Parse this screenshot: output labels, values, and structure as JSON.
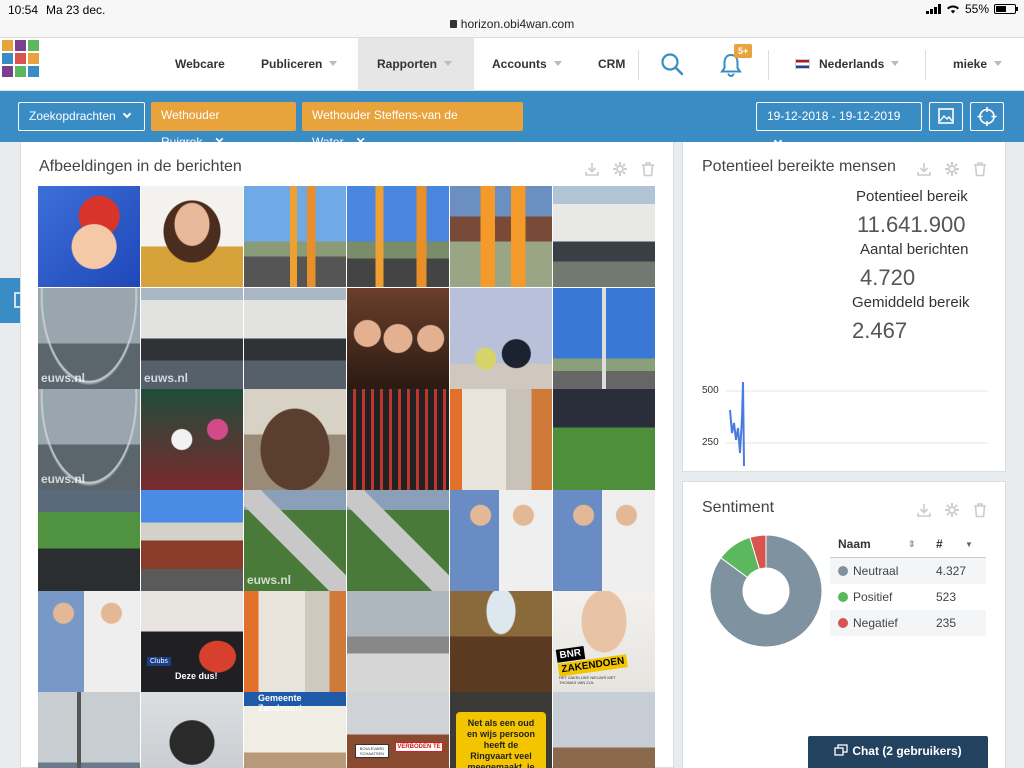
{
  "status": {
    "time": "10:54",
    "date": "Ma 23 dec.",
    "url": "horizon.obi4wan.com",
    "battery": "55%",
    "battery_level": 0.55
  },
  "nav": {
    "webcare": "Webcare",
    "publiceren": "Publiceren",
    "rapporten": "Rapporten",
    "accounts": "Accounts",
    "crm": "CRM",
    "notifications_badge": "5+",
    "language": "Nederlands",
    "user": "mieke"
  },
  "filters": {
    "query_dropdown": "Zoekopdrachten",
    "tags": [
      "Wethouder Ruigrok",
      "Wethouder Steffens-van de Water"
    ],
    "date_range": "19-12-2018 - 19-12-2019"
  },
  "images_panel": {
    "title": "Afbeeldingen in de berichten",
    "watermark": "euws.nl",
    "bnr_brand": "BNR",
    "bnr_show": "ZAKENDOEN",
    "bnr_tagline": "HET ZAKELIJKE NIEUWS MET THOMAS VAN ZIJL",
    "poster_a": "Deze dus!",
    "poster_b": "Clubs",
    "place_sign": "Gemeente Zandvoort",
    "street_sign": "VERBODEN TE",
    "street_sign_2": "BOULEVARD SCHAATSEN",
    "billboard": "Net als een oud en wijs persoon heeft de Ringvaart veel meegemaakt, je moet voorzichtig"
  },
  "reach_panel": {
    "title": "Potentieel bereikte mensen",
    "potential_reach_label": "Potentieel bereik",
    "potential_reach_value": "11.641.900",
    "messages_label": "Aantal berichten",
    "messages_value": "4.720",
    "avg_label": "Gemiddeld bereik",
    "avg_value": "2.467",
    "y_ticks": [
      "500",
      "250"
    ]
  },
  "sentiment_panel": {
    "title": "Sentiment",
    "col_name": "Naam",
    "col_count": "#",
    "rows": [
      {
        "name": "Neutraal",
        "value": "4.327",
        "color": "#7f929f"
      },
      {
        "name": "Positief",
        "value": "523",
        "color": "#5cb85c"
      },
      {
        "name": "Negatief",
        "value": "235",
        "color": "#d9534f"
      }
    ]
  },
  "chat": {
    "label": "Chat (2 gebruikers)"
  },
  "colors": {
    "primary": "#3a8dc4",
    "accent": "#e8a33d",
    "chat": "#23425f"
  }
}
